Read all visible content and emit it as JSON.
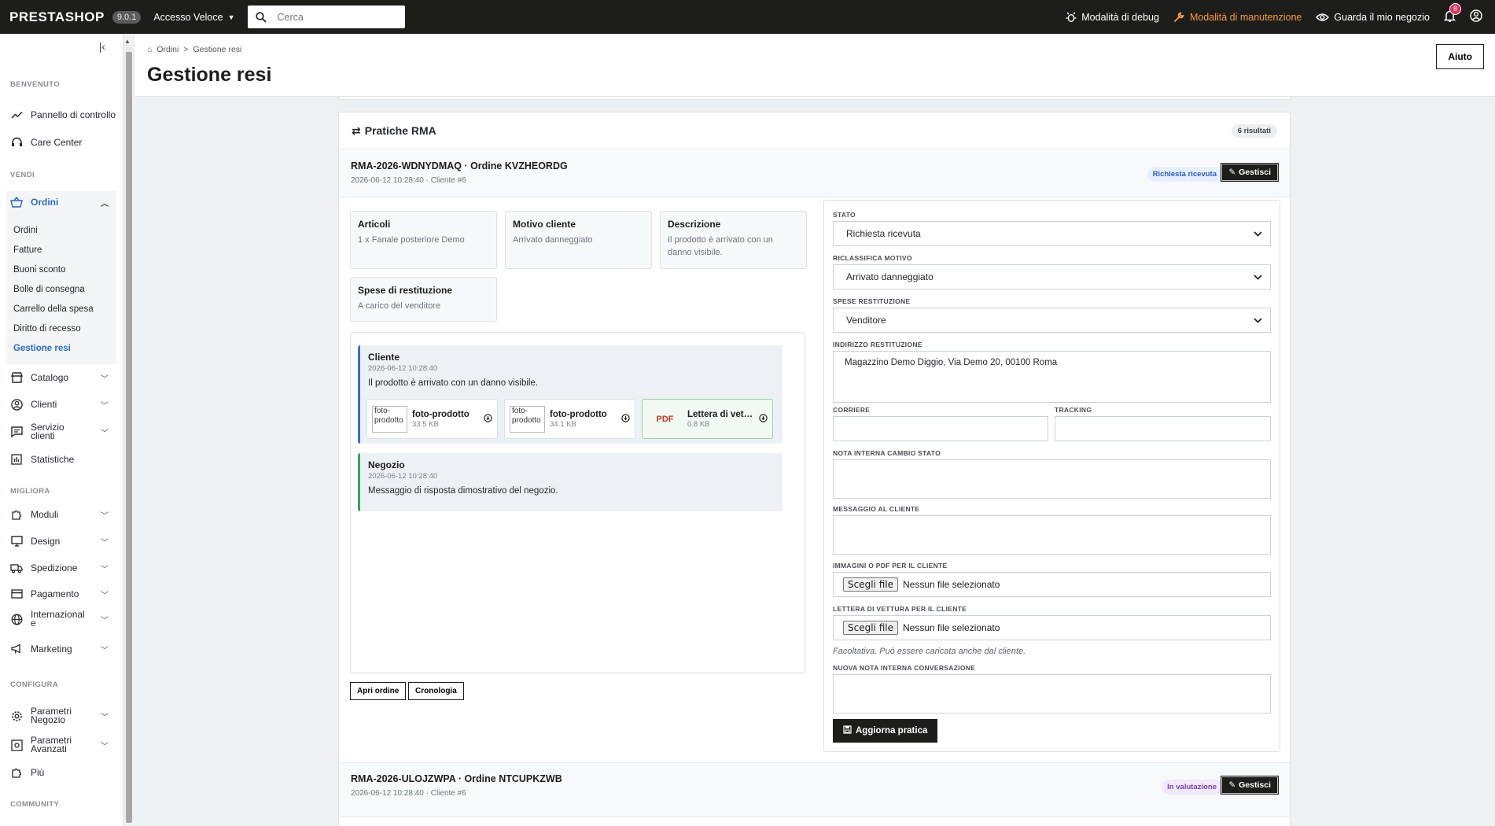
{
  "topbar": {
    "logo": "PRESTASHOP",
    "version": "9.0.1",
    "quick_access": "Accesso Veloce",
    "search_placeholder": "Cerca",
    "debug": "Modalità di debug",
    "maintenance": "Modalità di manutenzione",
    "view_shop": "Guarda il mio negozio",
    "notifications_count": "8"
  },
  "sidebar": {
    "sections": {
      "welcome": "BENVENUTO",
      "sell": "VENDI",
      "improve": "MIGLIORA",
      "configure": "CONFIGURA",
      "community": "COMMUNITY"
    },
    "dashboard": "Pannello di controllo",
    "care_center": "Care Center",
    "orders": "Ordini",
    "orders_sub": [
      "Ordini",
      "Fatture",
      "Buoni sconto",
      "Bolle di consegna",
      "Carrello della spesa",
      "Diritto di recesso",
      "Gestione resi"
    ],
    "catalog": "Catalogo",
    "customers": "Clienti",
    "customer_service": "Servizio clienti",
    "stats": "Statistiche",
    "modules": "Moduli",
    "design": "Design",
    "shipping": "Spedizione",
    "payment": "Pagamento",
    "international": "Internazionale",
    "marketing": "Marketing",
    "shop_params": "Parametri Negozio",
    "advanced_params": "Parametri Avanzati",
    "more": "Più"
  },
  "header": {
    "breadcrumb_parent": "Ordini",
    "breadcrumb_current": "Gestione resi",
    "title": "Gestione resi",
    "help": "Aiuto"
  },
  "card": {
    "title": "Pratiche RMA",
    "results": "6 risultati"
  },
  "rma1": {
    "title": "RMA-2026-WDNYDMAQ · Ordine KVZHEORDG",
    "meta": "2026-06-12 10:28:40 · Cliente #6",
    "status": "Richiesta ricevuta",
    "manage": "Gestisci",
    "articles_label": "Articoli",
    "articles_value": "1 x Fanale posteriore Demo",
    "reason_label": "Motivo cliente",
    "reason_value": "Arrivato danneggiato",
    "description_label": "Descrizione",
    "description_value": "Il prodotto è arrivato con un danno visibile.",
    "costs_label": "Spese di restituzione",
    "costs_value": "A carico del venditore",
    "messages": {
      "customer": {
        "author": "Cliente",
        "date": "2026-06-12 10:28:40",
        "text": "Il prodotto è arrivato con un danno visibile."
      },
      "shop": {
        "author": "Negozio",
        "date": "2026-06-12 10:28:40",
        "text": "Messaggio di risposta dimostrativo del negozio."
      }
    },
    "attachments": [
      {
        "thumb": "foto-prodotto",
        "name": "foto-prodotto",
        "size": "33.5 KB"
      },
      {
        "thumb": "foto-prodotto",
        "name": "foto-prodotto",
        "size": "34.1 KB"
      },
      {
        "thumb": "PDF",
        "name": "Lettera di vettura",
        "size": "0.8 KB"
      }
    ],
    "open_order": "Apri ordine",
    "history": "Cronologia"
  },
  "form": {
    "status_label": "STATO",
    "status_value": "Richiesta ricevuta",
    "reason_label": "RICLASSIFICA MOTIVO",
    "reason_value": "Arrivato danneggiato",
    "costs_label": "SPESE RESTITUZIONE",
    "costs_value": "Venditore",
    "address_label": "INDIRIZZO RESTITUZIONE",
    "address_value": "Magazzino Demo Diggio, Via Demo 20, 00100 Roma",
    "carrier_label": "CORRIERE",
    "tracking_label": "TRACKING",
    "internal_note_label": "NOTA INTERNA CAMBIO STATO",
    "customer_msg_label": "MESSAGGIO AL CLIENTE",
    "images_label": "IMMAGINI O PDF PER IL CLIENTE",
    "waybill_label": "LETTERA DI VETTURA PER IL CLIENTE",
    "file_button": "Scegli file",
    "no_file": "Nessun file selezionato",
    "waybill_hint": "Facoltativa. Può essere caricata anche dal cliente.",
    "conv_note_label": "NUOVA NOTA INTERNA CONVERSAZIONE",
    "submit": "Aggiorna pratica"
  },
  "rma2": {
    "title": "RMA-2026-ULOJZWPA · Ordine NTCUPKZWB",
    "meta": "2026-06-12 10:28:40 · Cliente #6",
    "status": "In valutazione",
    "manage": "Gestisci"
  }
}
